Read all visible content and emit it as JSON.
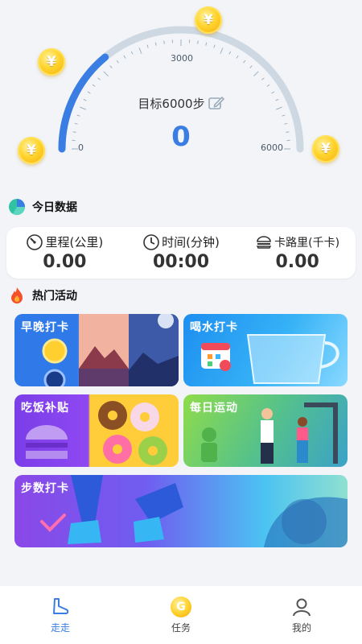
{
  "gauge": {
    "coin_symbol": "¥",
    "tick_min": "0",
    "tick_mid": "3000",
    "tick_max": "6000",
    "goal_text": "目标6000步",
    "current_steps": "0",
    "progress_fraction": 0.28,
    "colors": {
      "progress": "#3a7de3",
      "track": "#cdd8e2"
    }
  },
  "today": {
    "title": "今日数据",
    "stats": [
      {
        "label": "里程(公里)",
        "value": "0.00",
        "icon": "speedometer-icon"
      },
      {
        "label": "时间(分钟)",
        "value": "00:00",
        "icon": "clock-icon"
      },
      {
        "label": "卡路里(千卡)",
        "value": "0.00",
        "icon": "burger-icon"
      }
    ]
  },
  "activities": {
    "title": "热门活动",
    "items": [
      {
        "label": "早晚打卡"
      },
      {
        "label": "喝水打卡"
      },
      {
        "label": "吃饭补贴"
      },
      {
        "label": "每日运动"
      },
      {
        "label": "步数打卡"
      }
    ]
  },
  "nav": {
    "items": [
      {
        "label": "走走",
        "active": true
      },
      {
        "label": "任务",
        "active": false
      },
      {
        "label": "我的",
        "active": false
      }
    ],
    "coin_glyph": "G"
  }
}
